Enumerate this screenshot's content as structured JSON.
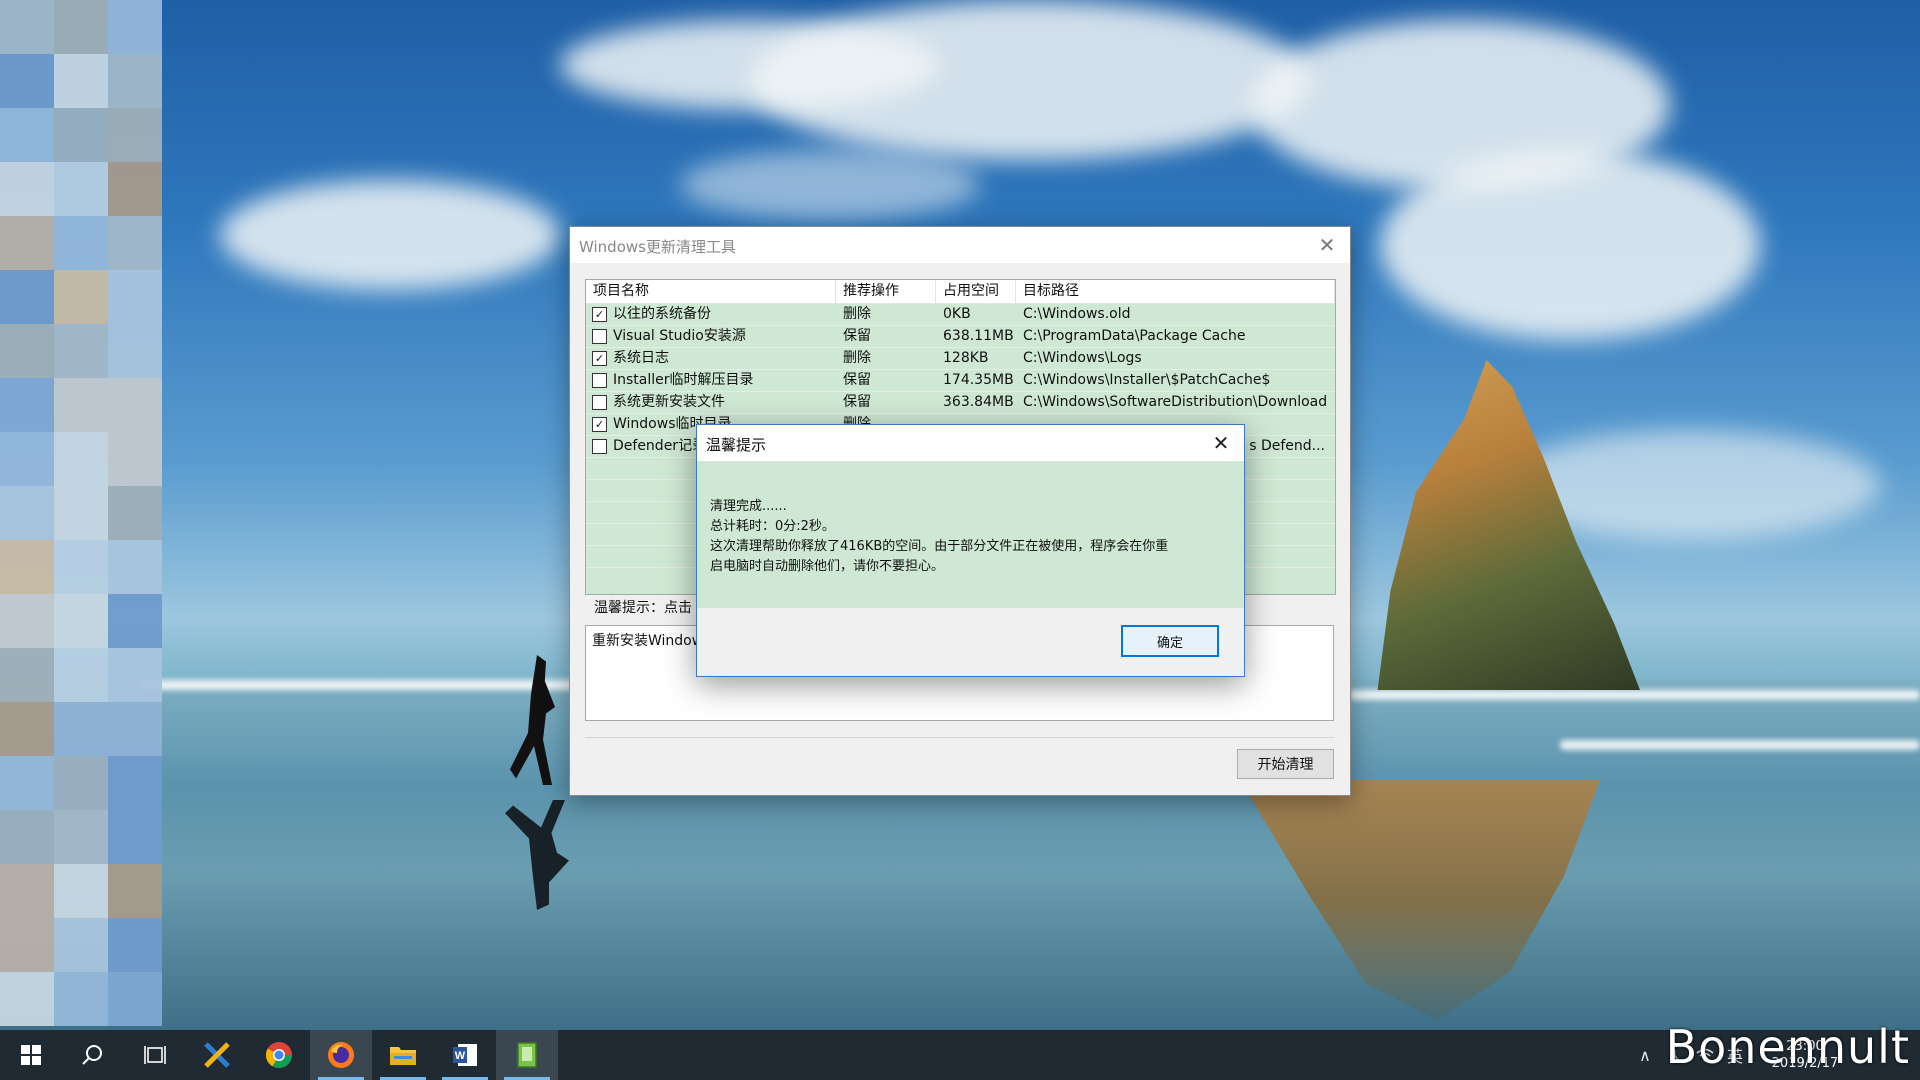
{
  "main_window": {
    "title": "Windows更新清理工具",
    "columns": [
      "项目名称",
      "推荐操作",
      "占用空间",
      "目标路径"
    ],
    "rows": [
      {
        "checked": true,
        "name": "以往的系统备份",
        "action": "删除",
        "size": "0KB",
        "path": "C:\\Windows.old"
      },
      {
        "checked": false,
        "name": "Visual Studio安装源",
        "action": "保留",
        "size": "638.11MB",
        "path": "C:\\ProgramData\\Package Cache"
      },
      {
        "checked": true,
        "name": "系统日志",
        "action": "删除",
        "size": "128KB",
        "path": "C:\\Windows\\Logs"
      },
      {
        "checked": false,
        "name": "Installer临时解压目录",
        "action": "保留",
        "size": "174.35MB",
        "path": "C:\\Windows\\Installer\\$PatchCache$"
      },
      {
        "checked": false,
        "name": "系统更新安装文件",
        "action": "保留",
        "size": "363.84MB",
        "path": "C:\\Windows\\SoftwareDistribution\\Download"
      },
      {
        "checked": true,
        "name": "Windows临时目录",
        "action": "删除",
        "size": "",
        "path": ""
      },
      {
        "checked": false,
        "name": "Defender记录",
        "action": "",
        "size": "",
        "path": "s Defend..."
      }
    ],
    "hint": "温馨提示：点击",
    "description": "重新安装Window",
    "start_button": "开始清理"
  },
  "dialog": {
    "title": "温馨提示",
    "lines": [
      "清理完成......",
      "总计耗时：0分:2秒。",
      "这次清理帮助你释放了416KB的空间。由于部分文件正在被使用，程序会在你重",
      "启电脑时自动删除他们，请你不要担心。"
    ],
    "ok_button": "确定"
  },
  "taskbar": {
    "apps": [
      "start-icon",
      "search-icon",
      "task-view-icon",
      "xmind-icon",
      "chrome-icon",
      "firefox-icon",
      "file-explorer-icon",
      "word-icon",
      "notepad-icon"
    ],
    "clock_time": "23:00",
    "clock_date": "2019/2/17"
  },
  "watermark": "Bonennult",
  "colors": {
    "list_bg": "#cfe8d3",
    "dialog_border": "#3c78c8",
    "taskbar_bg": "#1f2a33",
    "accent": "#0078d7"
  }
}
